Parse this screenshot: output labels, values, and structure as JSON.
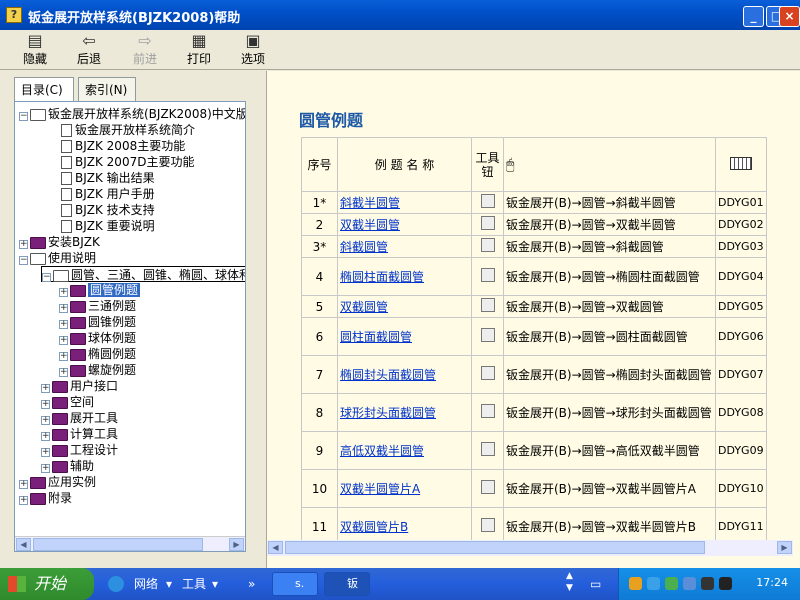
{
  "window": {
    "title": "钣金展开放样系统(BJZK2008)帮助",
    "minimize": "_",
    "maximize": "□",
    "close": "×"
  },
  "toolbar": {
    "buttons": [
      {
        "label": "隐藏",
        "icon": "hide-icon",
        "glyph": "▤"
      },
      {
        "label": "后退",
        "icon": "back-arrow-icon",
        "glyph": "⇦"
      },
      {
        "label": "前进",
        "icon": "forward-arrow-icon",
        "glyph": "⇨"
      },
      {
        "label": "打印",
        "icon": "printer-icon",
        "glyph": "▦"
      },
      {
        "label": "选项",
        "icon": "options-icon",
        "glyph": "▣"
      }
    ]
  },
  "tabs": {
    "contents": "目录(C)",
    "index": "索引(N)"
  },
  "tree": {
    "root": "钣金展开放样系统(BJZK2008)中文版",
    "root_children": [
      "钣金展开放样系统简介",
      "BJZK 2008主要功能",
      "BJZK 2007D主要功能",
      "BJZK 输出结果",
      "BJZK 用户手册",
      "BJZK 技术支持",
      "BJZK 重要说明"
    ],
    "install": "安装BJZK",
    "usage": "使用说明",
    "usage_sub": "圆管、三通、圆锥、椭圆、球体和螺旋",
    "examples": [
      "圆管例题",
      "三通例题",
      "圆锥例题",
      "球体例题",
      "椭圆例题",
      "螺旋例题"
    ],
    "more": [
      "用户接口",
      "空间",
      "展开工具",
      "计算工具",
      "工程设计",
      "辅助"
    ],
    "app": "应用实例",
    "appendix": "附录"
  },
  "content": {
    "heading": "圆管例题",
    "headers": {
      "no": "序号",
      "name": "例 题 名 称",
      "tool": "工具钮"
    },
    "rows": [
      {
        "no": "1*",
        "name": "斜截半圆管",
        "path": "钣金展开(B)→圆管→斜截半圆管",
        "code": "DDYG01"
      },
      {
        "no": "2",
        "name": "双截半圆管",
        "path": "钣金展开(B)→圆管→双截半圆管",
        "code": "DDYG02"
      },
      {
        "no": "3*",
        "name": "斜截圆管",
        "path": "钣金展开(B)→圆管→斜截圆管",
        "code": "DDYG03"
      },
      {
        "no": "4",
        "name": "椭圆柱面截圆管",
        "path": "钣金展开(B)→圆管→椭圆柱面截圆管",
        "code": "DDYG04"
      },
      {
        "no": "5",
        "name": "双截圆管",
        "path": "钣金展开(B)→圆管→双截圆管",
        "code": "DDYG05"
      },
      {
        "no": "6",
        "name": "圆柱面截圆管",
        "path": "钣金展开(B)→圆管→圆柱面截圆管",
        "code": "DDYG06"
      },
      {
        "no": "7",
        "name": "椭圆封头面截圆管",
        "path": "钣金展开(B)→圆管→椭圆封头面截圆管",
        "code": "DDYG07"
      },
      {
        "no": "8",
        "name": "球形封头面截圆管",
        "path": "钣金展开(B)→圆管→球形封头面截圆管",
        "code": "DDYG08"
      },
      {
        "no": "9",
        "name": "高低双截半圆管",
        "path": "钣金展开(B)→圆管→高低双截半圆管",
        "code": "DDYG09"
      },
      {
        "no": "10",
        "name": "双截半圆管片A",
        "path": "钣金展开(B)→圆管→双截半圆管片A",
        "code": "DDYG10"
      },
      {
        "no": "11",
        "name": "双截圆管片B",
        "path": "钣金展开(B)→圆管→双截半圆管片B",
        "code": "DDYG11"
      }
    ]
  },
  "taskbar": {
    "start": "开始",
    "network": "网络",
    "tools": "工具",
    "win1": "s.",
    "win2": "钣",
    "clock": "17:24"
  }
}
